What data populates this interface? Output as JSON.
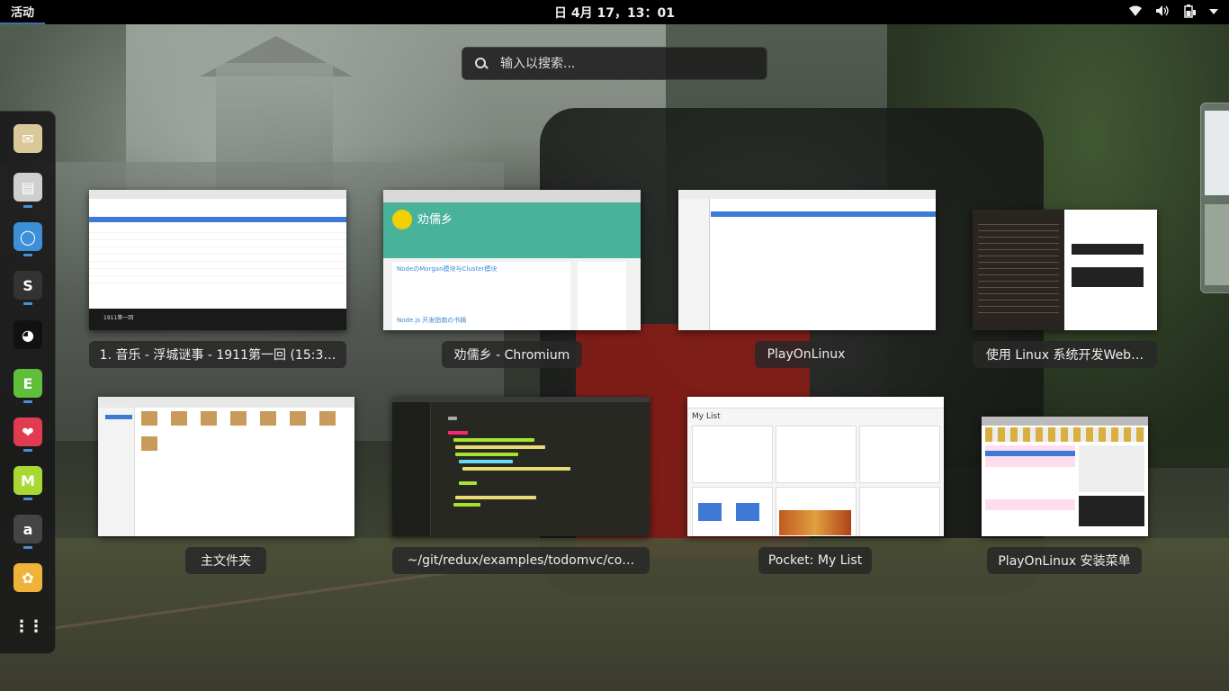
{
  "topbar": {
    "activities": "活动",
    "clock": "日 4月 17，13：01"
  },
  "search": {
    "placeholder": "输入以搜索..."
  },
  "dash": {
    "apps": [
      {
        "name": "mail-app-icon",
        "glyph": "✉",
        "bg": "#d9c99a"
      },
      {
        "name": "files-app-icon",
        "glyph": "▤",
        "bg": "#cfcfcf"
      },
      {
        "name": "chromium-app-icon",
        "glyph": "◯",
        "bg": "#3d8fd6"
      },
      {
        "name": "sublime-app-icon",
        "glyph": "S",
        "bg": "#333333"
      },
      {
        "name": "qq-app-icon",
        "glyph": "◕",
        "bg": "#111111"
      },
      {
        "name": "evernote-app-icon",
        "glyph": "E",
        "bg": "#5fbf3a"
      },
      {
        "name": "pocket-app-icon",
        "glyph": "❤",
        "bg": "#e03b4f"
      },
      {
        "name": "mendeley-app-icon",
        "glyph": "M",
        "bg": "#a9d833"
      },
      {
        "name": "amazon-app-icon",
        "glyph": "a",
        "bg": "#444444"
      },
      {
        "name": "playonlinux-app-icon",
        "glyph": "✿",
        "bg": "#f0b33a"
      },
      {
        "name": "app-grid-icon",
        "glyph": "⋮⋮",
        "bg": "transparent"
      }
    ]
  },
  "windows": [
    {
      "caption": "1. 音乐 - 浮城谜事 - 1911第一回 (15:3…",
      "thumb_title": "1911第一回"
    },
    {
      "caption": "劝儒乡 - Chromium",
      "thumb_title": "劝儒乡",
      "thumb_post1": "NodeのMorgan模块与Cluster模块",
      "thumb_post2": "Node.js 开发指南の书摘"
    },
    {
      "caption": "PlayOnLinux"
    },
    {
      "caption": "使用 Linux 系统开发Web…"
    },
    {
      "caption": "主文件夹"
    },
    {
      "caption": "~/git/redux/examples/todomvc/co…"
    },
    {
      "caption": "Pocket: My List",
      "thumb_title": "My List"
    },
    {
      "caption": "PlayOnLinux 安装菜单"
    }
  ]
}
